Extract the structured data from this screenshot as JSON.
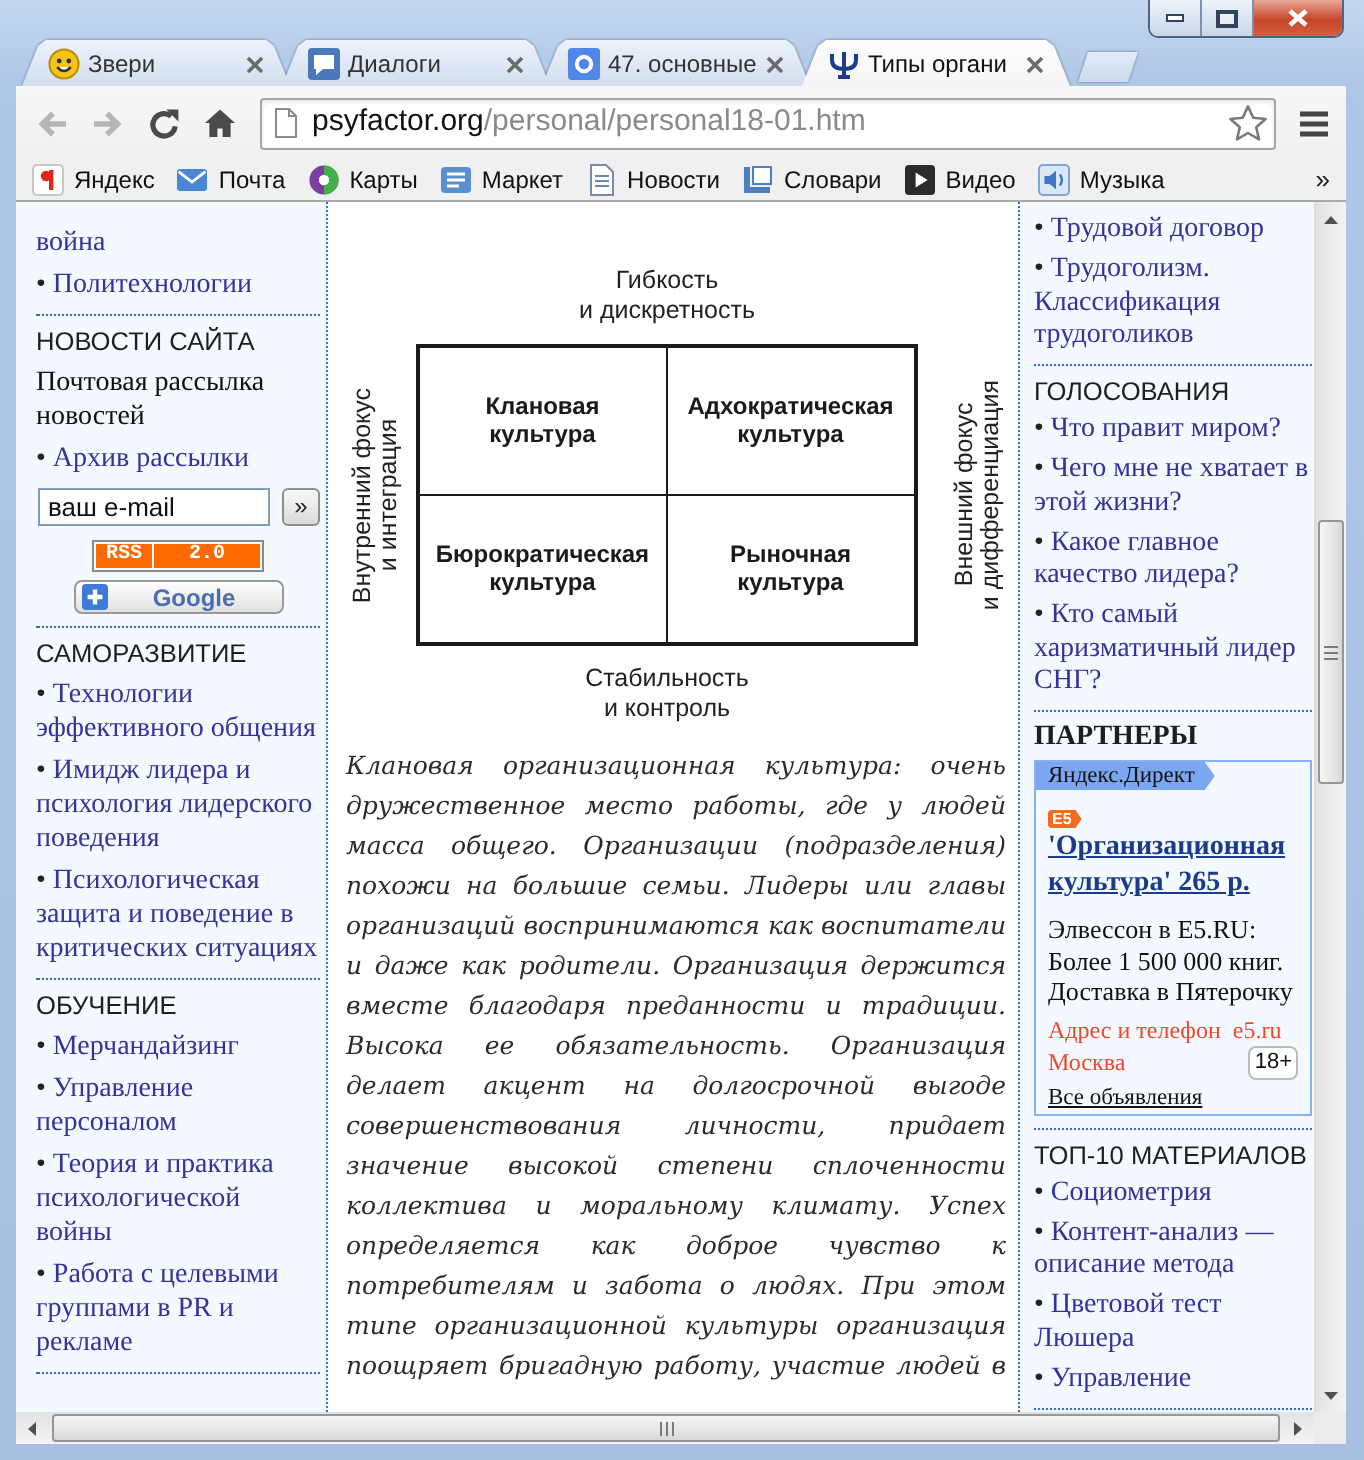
{
  "tabs": [
    {
      "title": "Звери",
      "selected": false
    },
    {
      "title": "Диалоги",
      "selected": false
    },
    {
      "title": "47. основные",
      "selected": false
    },
    {
      "title": "Типы органи",
      "selected": true
    }
  ],
  "toolbar": {
    "back": {
      "disabled": true
    },
    "forward": {
      "disabled": true
    },
    "address": {
      "host": "psyfactor.org",
      "path": "/personal/personal18-01.htm"
    }
  },
  "bookmarks": [
    {
      "label": "Яндекс"
    },
    {
      "label": "Почта"
    },
    {
      "label": "Карты"
    },
    {
      "label": "Маркет"
    },
    {
      "label": "Новости"
    },
    {
      "label": "Словари"
    },
    {
      "label": "Видео"
    },
    {
      "label": "Музыка"
    }
  ],
  "bookmarks_more": "»",
  "left_sidebar": {
    "sections": [
      {
        "items": [
          {
            "text": "война"
          },
          {
            "bullet": "•",
            "text": "Политехнологии"
          }
        ]
      },
      {
        "heading": "НОВОСТИ САЙТА",
        "note": "Почтовая рассылка новостей",
        "items": [
          {
            "bullet": "•",
            "text": "Архив рассылки"
          }
        ],
        "subscribe": {
          "value": "ваш e-mail",
          "button": "»"
        },
        "rss": {
          "label": "RSS",
          "version": "2.0"
        },
        "google_button": "Google"
      },
      {
        "heading": "САМОРАЗВИТИЕ",
        "items": [
          {
            "bullet": "•",
            "text": "Технологии эффективного общения"
          },
          {
            "bullet": "•",
            "text": "Имидж лидера и психология лидерского поведения"
          },
          {
            "bullet": "•",
            "text": "Психологическая защита и поведение в критических ситуациях"
          }
        ]
      },
      {
        "heading": "ОБУЧЕНИЕ",
        "items": [
          {
            "bullet": "•",
            "text": "Мерчандайзинг"
          },
          {
            "bullet": "•",
            "text": "Управление персоналом"
          },
          {
            "bullet": "•",
            "text": "Теория и практика психологической войны"
          },
          {
            "bullet": "•",
            "text": "Работа с целевыми группами в PR и рекламе"
          }
        ]
      }
    ]
  },
  "article": {
    "figure": {
      "top": "Гибкость\nи дискретность",
      "left": "Внутренний фокус\nи интеграция",
      "right": "Внешний фокус\nи дифференциация",
      "bottom": "Стабильность\nи контроль",
      "quadrants": [
        "Клановая культура",
        "Адхократическая культура",
        "Бюрократическая культура",
        "Рыночная культура"
      ]
    },
    "paragraph": "Клановая организационная культура: очень дружественное место работы, где у людей масса общего. Организации (подразделения) похожи на большие семьи. Лидеры или главы организаций воспринимаются как воспитатели и даже как родители. Организация держится вместе благодаря преданности и традиции. Высока ее обязательность. Организация делает акцент на долгосрочной выгоде совершенствования личности, придает значение высокой степени сплоченности коллектива и моральному климату. Успех определяется как доброе чувство к потребителям и забота о людях. При этом типе организационной культуры организация поощряет бригадную работу, участие людей в"
  },
  "right_sidebar": {
    "sections": [
      {
        "items": [
          {
            "bullet": "•",
            "text": "Трудовой договор"
          },
          {
            "bullet": "•",
            "text": "Трудоголизм. Классификация трудоголиков"
          }
        ]
      },
      {
        "heading": "ГОЛОСОВАНИЯ",
        "items": [
          {
            "bullet": "•",
            "text": "Что правит миром?"
          },
          {
            "bullet": "•",
            "text": "Чего мне не хватает в этой жизни?"
          },
          {
            "bullet": "•",
            "text": "Какое главное качество лидера?"
          },
          {
            "bullet": "•",
            "text": "Кто самый харизматичный лидер СНГ?"
          }
        ]
      },
      {
        "heading": "ПАРТНЕРЫ",
        "ad": {
          "source": "Яндекс.Директ",
          "logo": "E5",
          "title": "'Организационная культура' 265 р.",
          "text": "Элвессон в E5.RU: Более 1 500 000 книг. Доставка в Пятерочку",
          "contact": "Адрес и телефон",
          "domain": "e5.ru",
          "city": "Москва",
          "age": "18+",
          "all_ads": "Все объявления"
        }
      },
      {
        "heading": "ТОП-10 МАТЕРИАЛОВ",
        "items": [
          {
            "bullet": "•",
            "text": "Социометрия"
          },
          {
            "bullet": "•",
            "text": "Контент-анализ — описание метода"
          },
          {
            "bullet": "•",
            "text": "Цветовой тест Люшера"
          },
          {
            "bullet": "•",
            "text": "Управление"
          }
        ]
      }
    ]
  }
}
